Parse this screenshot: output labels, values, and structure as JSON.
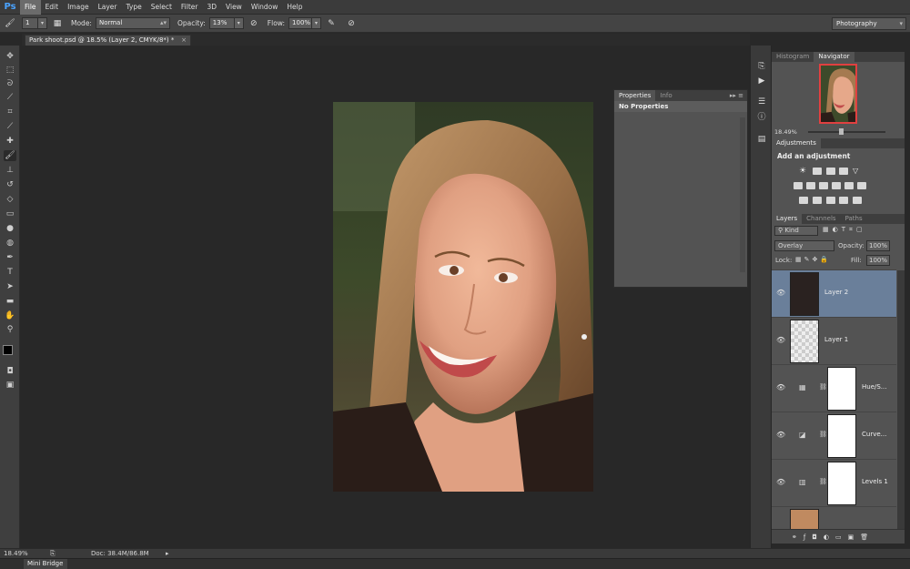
{
  "app": {
    "logo": "Ps"
  },
  "menu": [
    "File",
    "Edit",
    "Image",
    "Layer",
    "Type",
    "Select",
    "Filter",
    "3D",
    "View",
    "Window",
    "Help"
  ],
  "options": {
    "brush_size": "1",
    "mode_label": "Mode:",
    "mode_value": "Normal",
    "opacity_label": "Opacity:",
    "opacity_value": "13%",
    "flow_label": "Flow:",
    "flow_value": "100%",
    "workspace": "Photography"
  },
  "document_tab": {
    "title": "Park shoot.psd @ 18.5% (Layer 2, CMYK/8*) *",
    "close": "×"
  },
  "properties_panel": {
    "tabs": [
      "Properties",
      "Info"
    ],
    "content": "No Properties"
  },
  "navigator_panel": {
    "tabs": [
      "Histogram",
      "Navigator"
    ],
    "zoom": "18.49%"
  },
  "adjustments_panel": {
    "tab": "Adjustments",
    "heading": "Add an adjustment"
  },
  "layers_panel": {
    "tabs": [
      "Layers",
      "Channels",
      "Paths"
    ],
    "filter": "Kind",
    "blend_mode": "Overlay",
    "opacity_label": "Opacity:",
    "opacity_value": "100%",
    "lock_label": "Lock:",
    "fill_label": "Fill:",
    "fill_value": "100%",
    "layers": [
      {
        "name": "Layer 2",
        "selected": true
      },
      {
        "name": "Layer 1",
        "selected": false
      },
      {
        "name": "Hue/S...",
        "selected": false
      },
      {
        "name": "Curve...",
        "selected": false
      },
      {
        "name": "Levels 1",
        "selected": false
      }
    ]
  },
  "status": {
    "zoom": "18.49%",
    "doc": "Doc: 38.4M/86.8M"
  },
  "bottom_panel": {
    "tab": "Mini Bridge"
  },
  "colors": {
    "selection": "#6a7f9a",
    "navigator_box": "#e04040",
    "ps_blue": "#4aa3ff"
  }
}
